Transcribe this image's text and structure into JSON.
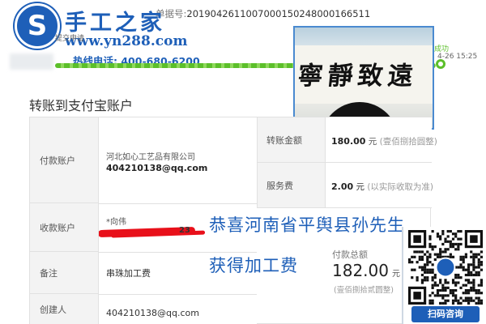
{
  "order": {
    "label": "单据号:",
    "number": "2019042611007000150248000166511"
  },
  "brand": {
    "logo_glyph": "S",
    "name": "手工之家",
    "url": "www.yn288.com",
    "phone": "热线电话: 400-680-6200"
  },
  "progress": {
    "step_submit": "提交申请",
    "step_done": "成功",
    "done_time": "4-26 15:25"
  },
  "photo": {
    "calligraphy": "寧靜致遠"
  },
  "page": {
    "title": "转账到支付宝账户"
  },
  "table": {
    "payer_label": "付款账户",
    "payer_name": "河北如心工艺品有限公司",
    "payer_email": "404210138@qq.com",
    "receiver_label": "收款账户",
    "receiver_name": "*向伟",
    "receiver_tail": "23",
    "memo_label": "备注",
    "memo_value": "串珠加工费",
    "creator_label": "创建人",
    "creator_value": "404210138@qq.com",
    "amount_label": "转账金额",
    "amount_value": "180.00",
    "amount_unit": "元",
    "amount_note": "(壹佰捌拾圆整)",
    "fee_label": "服务费",
    "fee_value": "2.00",
    "fee_unit": "元",
    "fee_note": "(以实际收取为准)"
  },
  "payment": {
    "label": "付款总额",
    "value": "182.00",
    "unit": "元",
    "note": "(壹佰捌拾贰圆整)"
  },
  "congrats": {
    "line1": "恭喜河南省平舆县孙先生",
    "line2": "获得加工费"
  },
  "qr": {
    "button_label": "扫码咨询"
  },
  "colors": {
    "brand_blue": "#1e5fb8",
    "progress_green": "#5cbf2a",
    "highlight_red": "#e8101a"
  }
}
